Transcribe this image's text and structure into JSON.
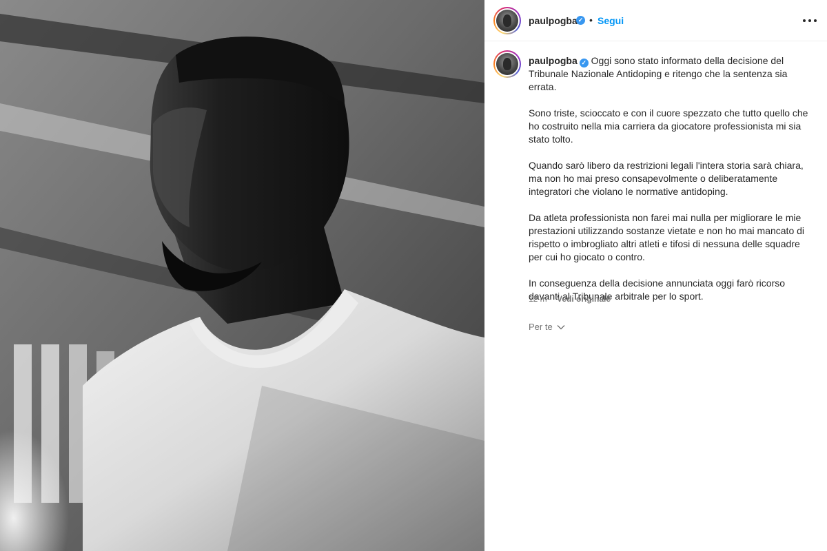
{
  "post": {
    "username": "paulpogba",
    "verified_mark": "✓",
    "separator": "•",
    "follow_label": "Segui",
    "more_icon": "more-horizontal-icon",
    "caption_paragraphs": [
      "Oggi sono stato informato della decisione del Tribunale Nazionale Antidoping e ritengo che la sentenza sia errata.",
      "Sono triste, scioccato e con il cuore spezzato che tutto quello che ho costruito nella mia carriera da giocatore professionista mi sia stato tolto.",
      "Quando sarò libero da restrizioni legali l'intera storia sarà chiara, ma non ho mai preso consapevolmente o deliberatamente integratori che violano le normative antidoping.",
      "Da atleta professionista non farei mai nulla per migliorare le mie prestazioni utilizzando sostanze vietate e non ho mai mancato di rispetto o imbrogliato altri atleti e tifosi di nessuna delle squadre per cui ho giocato o contro.",
      "In conseguenza della decisione annunciata oggi farò ricorso davanti al Tribunale arbitrale per lo sport."
    ],
    "time_ago": "12 m",
    "see_original": "Vedi originale",
    "for_you_label": "Per te"
  },
  "colors": {
    "link_blue": "#0095f6",
    "verified_blue": "#3897f0",
    "text": "#262626",
    "muted": "#737373"
  }
}
